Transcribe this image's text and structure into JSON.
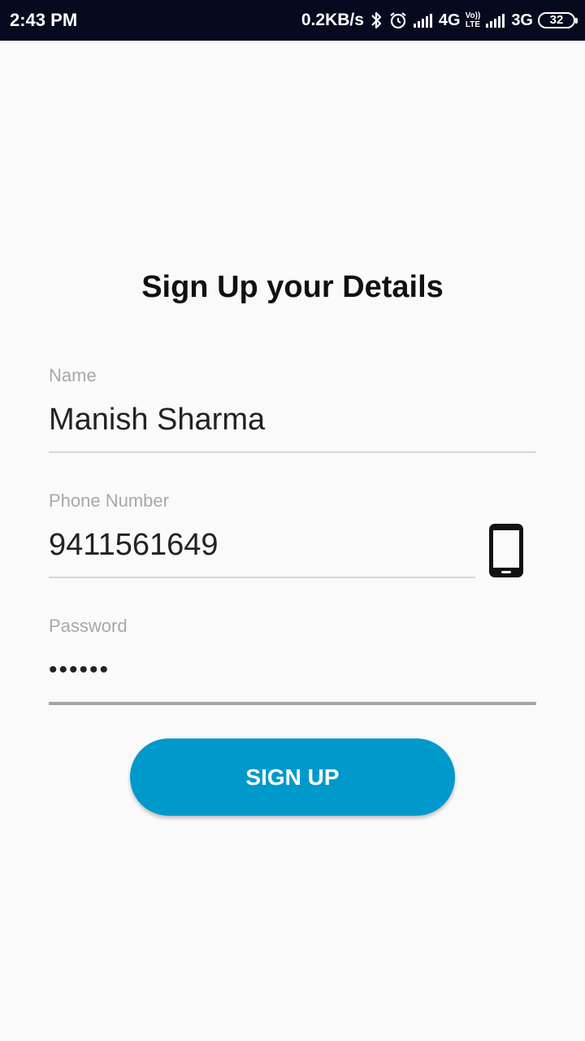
{
  "status_bar": {
    "time": "2:43 PM",
    "net_speed": "0.2KB/s",
    "network_1": "4G",
    "volte_top": "Vo))",
    "volte_bottom": "LTE",
    "network_2": "3G",
    "battery": "32",
    "icons": [
      "bluetooth-icon",
      "alarm-icon",
      "signal-icon",
      "signal-icon",
      "battery-icon"
    ]
  },
  "form": {
    "title": "Sign Up your Details",
    "name": {
      "label": "Name",
      "value": "Manish Sharma"
    },
    "phone": {
      "label": "Phone Number",
      "value": "9411561649",
      "icon": "smartphone-icon"
    },
    "password": {
      "label": "Password",
      "value": "••••••"
    },
    "submit_label": "SIGN UP"
  },
  "colors": {
    "status_bar_bg": "#050a1e",
    "background": "#fafafa",
    "button": "#0099cc",
    "label": "#a8a8a8"
  }
}
